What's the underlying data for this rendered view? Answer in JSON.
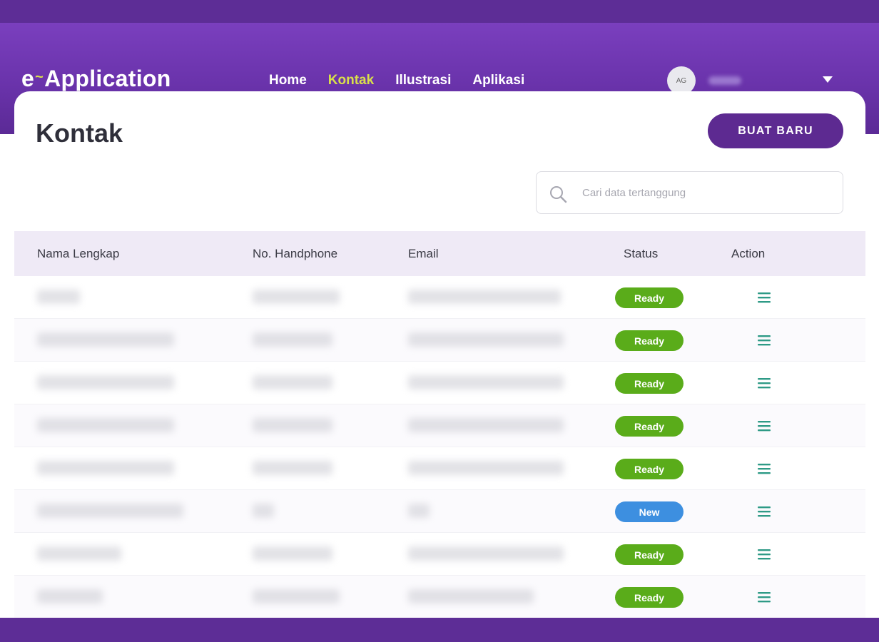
{
  "app": {
    "logo_prefix": "e",
    "logo_suffix": "Application"
  },
  "nav": {
    "items": [
      {
        "label": "Home",
        "active": false
      },
      {
        "label": "Kontak",
        "active": true
      },
      {
        "label": "Illustrasi",
        "active": false
      },
      {
        "label": "Aplikasi",
        "active": false
      }
    ]
  },
  "user": {
    "initials": "AG",
    "name": ""
  },
  "page": {
    "title": "Kontak",
    "new_button_label": "BUAT BARU"
  },
  "search": {
    "value": "",
    "placeholder": "Cari data tertanggung"
  },
  "table": {
    "columns": [
      "Nama Lengkap",
      "No. Handphone",
      "Email",
      "Status",
      "Action"
    ],
    "rows": [
      {
        "name": "",
        "phone": "",
        "email": "",
        "status": "Ready"
      },
      {
        "name": "",
        "phone": "",
        "email": "",
        "status": "Ready"
      },
      {
        "name": "",
        "phone": "",
        "email": "",
        "status": "Ready"
      },
      {
        "name": "",
        "phone": "",
        "email": "",
        "status": "Ready"
      },
      {
        "name": "",
        "phone": "",
        "email": "",
        "status": "Ready"
      },
      {
        "name": "",
        "phone": "",
        "email": "",
        "status": "New"
      },
      {
        "name": "",
        "phone": "",
        "email": "",
        "status": "Ready"
      },
      {
        "name": "",
        "phone": "",
        "email": "",
        "status": "Ready"
      }
    ]
  },
  "colors": {
    "brand_purple": "#6a33ab",
    "accent_yellow": "#d9e04a",
    "status_ready": "#5aac1a",
    "status_new": "#3d8fe0",
    "action_icon": "#2e9a86"
  },
  "icons": {
    "search": "search-icon",
    "user_menu": "caret-down-icon",
    "row_action": "menu-icon"
  }
}
